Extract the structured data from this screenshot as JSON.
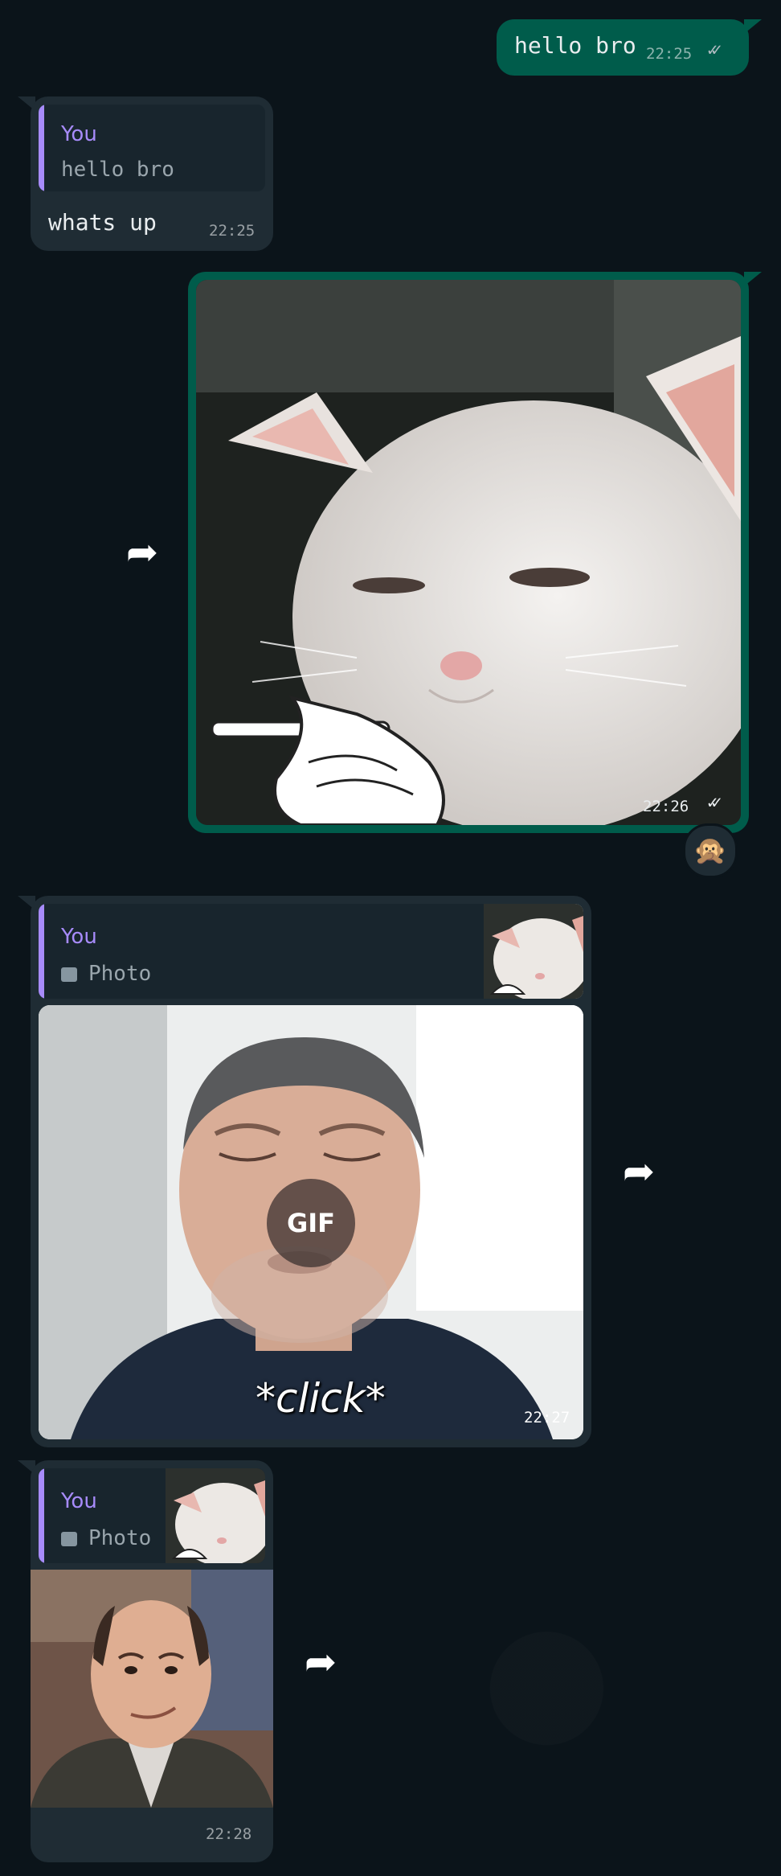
{
  "messages": {
    "m1": {
      "text": "hello bro",
      "time": "22:25",
      "ticks": "✓✓"
    },
    "m2": {
      "reply_name": "You",
      "reply_text": "hello bro",
      "text": "whats up",
      "time": "22:25"
    },
    "m3": {
      "time": "22:26",
      "ticks": "✓✓",
      "reaction": "🙊",
      "image": "cat-smoking-meme"
    },
    "m4": {
      "reply_name": "You",
      "reply_text": "Photo",
      "time": "22:27",
      "gif_badge": "GIF",
      "caption_in_image": "*click*",
      "image": "man-click-gif"
    },
    "m5": {
      "reply_name": "You",
      "reply_text": "Photo",
      "time": "22:28",
      "image": "man-smirk"
    }
  },
  "icons": {
    "forward": "forward-arrow-icon",
    "photo": "photo-icon",
    "read": "double-check-icon"
  },
  "colors": {
    "outgoing": "#005c4b",
    "incoming": "#1f2c34",
    "reply_accent": "#a78bfa",
    "background": "#0b141a"
  }
}
